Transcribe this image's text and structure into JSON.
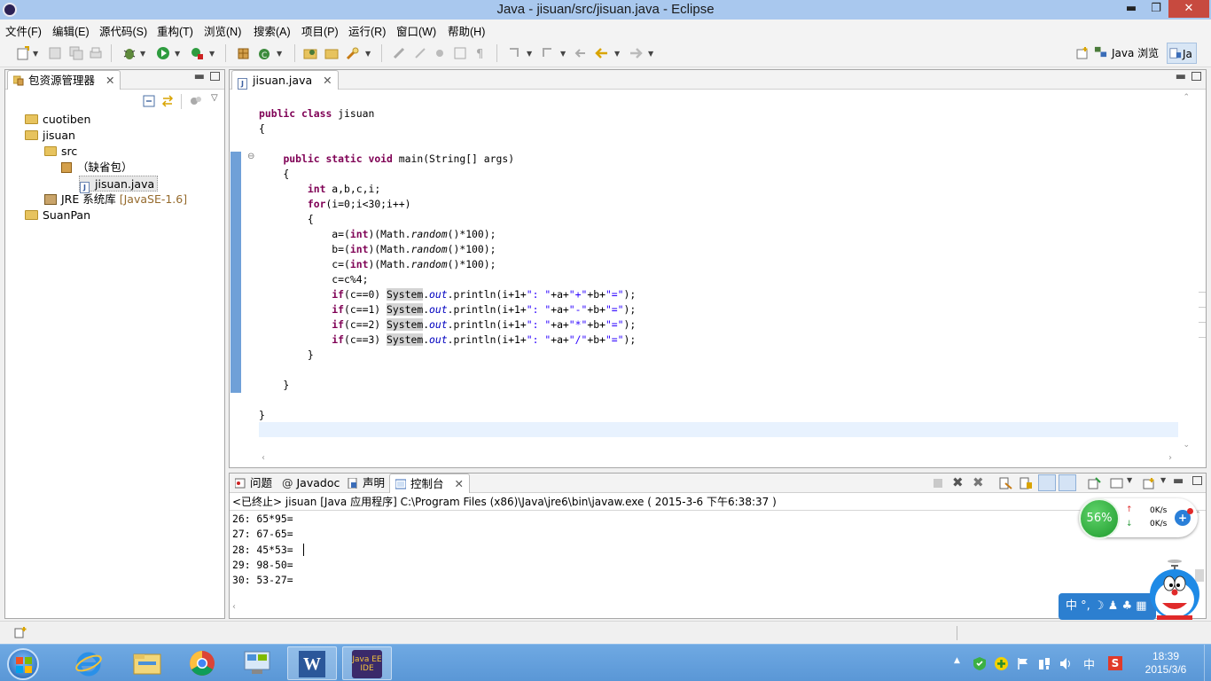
{
  "window": {
    "title": "Java - jisuan/src/jisuan.java - Eclipse",
    "min_glyph": "▬",
    "max_glyph": "❐",
    "close_glyph": "✕"
  },
  "menu": [
    "文件(F)",
    "编辑(E)",
    "源代码(S)",
    "重构(T)",
    "浏览(N)",
    "搜索(A)",
    "项目(P)",
    "运行(R)",
    "窗口(W)",
    "帮助(H)"
  ],
  "perspectives": {
    "java_browse": "Java 浏览",
    "java": "Ja"
  },
  "explorer": {
    "tab_label": "包资源管理器",
    "tree": [
      {
        "label": "cuotiben"
      },
      {
        "label": "jisuan"
      },
      {
        "label": "src"
      },
      {
        "label": "（缺省包）"
      },
      {
        "label": "jisuan.java"
      },
      {
        "label": "JRE 系统库",
        "suffix": "[JavaSE-1.6]"
      },
      {
        "label": "SuanPan"
      }
    ]
  },
  "editor": {
    "tab_label": "jisuan.java",
    "fold_marker": "⊖"
  },
  "bottom_tabs": {
    "problems": "问题",
    "javadoc": "Javadoc",
    "declaration": "声明",
    "console": "控制台"
  },
  "console": {
    "header": "<已终止> jisuan [Java 应用程序] C:\\Program Files (x86)\\Java\\jre6\\bin\\javaw.exe ( 2015-3-6 下午6:38:37 )",
    "lines": [
      "26: 65*95=",
      "27: 67-65=",
      "28: 45*53=",
      "29: 98-50=",
      "30: 53-27="
    ]
  },
  "speed_widget": {
    "percent": "56%",
    "up": "0K/s",
    "down": "0K/s",
    "plus": "+"
  },
  "ime_bar": {
    "text": "中 °, ☽ ♟ ♣ ▦"
  },
  "taskbar": {
    "clock_time": "18:39",
    "clock_date": "2015/3/6",
    "ime_lang": "中",
    "ide_label": "Java EE IDE",
    "word_label": "W"
  },
  "colors": {
    "keyword": "#7f0055",
    "string": "#2a00ff",
    "field": "#0000c0",
    "taskbar": "#5a97d6"
  }
}
